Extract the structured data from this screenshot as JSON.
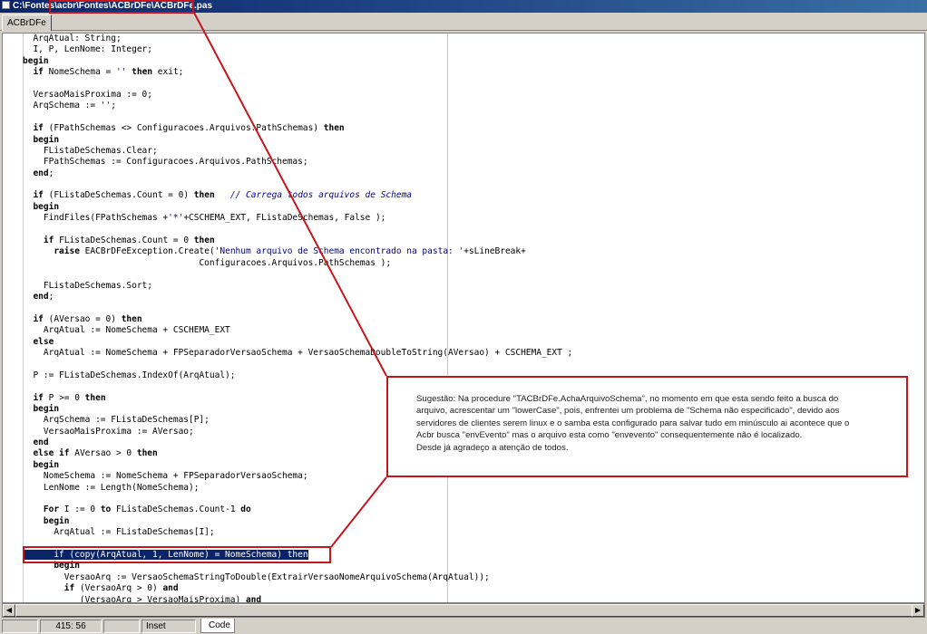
{
  "window": {
    "title": "C:\\Fontes\\acbr\\Fontes\\ACBrDFe\\ACBrDFe.pas"
  },
  "tabs": [
    {
      "label": "ACBrDFe"
    }
  ],
  "code_lines": [
    [
      {
        "t": "  ArqAtual: String;"
      }
    ],
    [
      {
        "t": "  I, P, LenNome: Integer;"
      }
    ],
    [
      {
        "t": "begin",
        "c": "kw"
      }
    ],
    [
      {
        "t": "  "
      },
      {
        "t": "if",
        "c": "kw"
      },
      {
        "t": " NomeSchema = "
      },
      {
        "t": "''",
        "c": "str"
      },
      {
        "t": " "
      },
      {
        "t": "then",
        "c": "kw"
      },
      {
        "t": " exit;"
      }
    ],
    [
      {
        "t": ""
      }
    ],
    [
      {
        "t": "  VersaoMaisProxima := 0;"
      }
    ],
    [
      {
        "t": "  ArqSchema := "
      },
      {
        "t": "''",
        "c": "str"
      },
      {
        "t": ";"
      }
    ],
    [
      {
        "t": ""
      }
    ],
    [
      {
        "t": "  "
      },
      {
        "t": "if",
        "c": "kw"
      },
      {
        "t": " (FPathSchemas <> Configuracoes.Arquivos.PathSchemas) "
      },
      {
        "t": "then",
        "c": "kw"
      }
    ],
    [
      {
        "t": "  "
      },
      {
        "t": "begin",
        "c": "kw"
      }
    ],
    [
      {
        "t": "    FListaDeSchemas.Clear;"
      }
    ],
    [
      {
        "t": "    FPathSchemas := Configuracoes.Arquivos.PathSchemas;"
      }
    ],
    [
      {
        "t": "  "
      },
      {
        "t": "end",
        "c": "kw"
      },
      {
        "t": ";"
      }
    ],
    [
      {
        "t": ""
      }
    ],
    [
      {
        "t": "  "
      },
      {
        "t": "if",
        "c": "kw"
      },
      {
        "t": " (FListaDeSchemas.Count = 0) "
      },
      {
        "t": "then",
        "c": "kw"
      },
      {
        "t": "   "
      },
      {
        "t": "// Carrega todos arquivos de Schema",
        "c": "cm"
      }
    ],
    [
      {
        "t": "  "
      },
      {
        "t": "begin",
        "c": "kw"
      }
    ],
    [
      {
        "t": "    FindFiles(FPathSchemas +"
      },
      {
        "t": "'*'",
        "c": "str"
      },
      {
        "t": "+CSCHEMA_EXT, FListaDeSchemas, False );"
      }
    ],
    [
      {
        "t": ""
      }
    ],
    [
      {
        "t": "    "
      },
      {
        "t": "if",
        "c": "kw"
      },
      {
        "t": " FListaDeSchemas.Count = 0 "
      },
      {
        "t": "then",
        "c": "kw"
      }
    ],
    [
      {
        "t": "      "
      },
      {
        "t": "raise",
        "c": "kw"
      },
      {
        "t": " EACBrDFeException.Create("
      },
      {
        "t": "'Nenhum arquivo de Schema encontrado na pasta: '",
        "c": "str"
      },
      {
        "t": "+sLineBreak+"
      }
    ],
    [
      {
        "t": "                                  Configuracoes.Arquivos.PathSchemas );"
      }
    ],
    [
      {
        "t": ""
      }
    ],
    [
      {
        "t": "    FListaDeSchemas.Sort;"
      }
    ],
    [
      {
        "t": "  "
      },
      {
        "t": "end",
        "c": "kw"
      },
      {
        "t": ";"
      }
    ],
    [
      {
        "t": ""
      }
    ],
    [
      {
        "t": "  "
      },
      {
        "t": "if",
        "c": "kw"
      },
      {
        "t": " (AVersao = 0) "
      },
      {
        "t": "then",
        "c": "kw"
      }
    ],
    [
      {
        "t": "    ArqAtual := NomeSchema + CSCHEMA_EXT"
      }
    ],
    [
      {
        "t": "  "
      },
      {
        "t": "else",
        "c": "kw"
      }
    ],
    [
      {
        "t": "    ArqAtual := NomeSchema + FPSeparadorVersaoSchema + VersaoSchemaDoubleToString(AVersao) + CSCHEMA_EXT ;"
      }
    ],
    [
      {
        "t": ""
      }
    ],
    [
      {
        "t": "  P := FListaDeSchemas.IndexOf(ArqAtual);"
      }
    ],
    [
      {
        "t": ""
      }
    ],
    [
      {
        "t": "  "
      },
      {
        "t": "if",
        "c": "kw"
      },
      {
        "t": " P >= 0 "
      },
      {
        "t": "then",
        "c": "kw"
      }
    ],
    [
      {
        "t": "  "
      },
      {
        "t": "begin",
        "c": "kw"
      }
    ],
    [
      {
        "t": "    ArqSchema := FListaDeSchemas[P];"
      }
    ],
    [
      {
        "t": "    VersaoMaisProxima := AVersao;"
      }
    ],
    [
      {
        "t": "  "
      },
      {
        "t": "end",
        "c": "kw"
      }
    ],
    [
      {
        "t": "  "
      },
      {
        "t": "else if",
        "c": "kw"
      },
      {
        "t": " AVersao > 0 "
      },
      {
        "t": "then",
        "c": "kw"
      }
    ],
    [
      {
        "t": "  "
      },
      {
        "t": "begin",
        "c": "kw"
      }
    ],
    [
      {
        "t": "    NomeSchema := NomeSchema + FPSeparadorVersaoSchema;"
      }
    ],
    [
      {
        "t": "    LenNome := Length(NomeSchema);"
      }
    ],
    [
      {
        "t": ""
      }
    ],
    [
      {
        "t": "    "
      },
      {
        "t": "For",
        "c": "kw"
      },
      {
        "t": " I := 0 "
      },
      {
        "t": "to",
        "c": "kw"
      },
      {
        "t": " FListaDeSchemas.Count-1 "
      },
      {
        "t": "do",
        "c": "kw"
      }
    ],
    [
      {
        "t": "    "
      },
      {
        "t": "begin",
        "c": "kw"
      }
    ],
    [
      {
        "t": "      ArqAtual := FListaDeSchemas[I];"
      }
    ],
    [
      {
        "t": ""
      }
    ],
    [
      {
        "t": "      if (copy(ArqAtual, 1, LenNome) = NomeSchema) then",
        "c": "sel"
      }
    ],
    [
      {
        "t": "      "
      },
      {
        "t": "begin",
        "c": "kw"
      }
    ],
    [
      {
        "t": "        VersaoArq := VersaoSchemaStringToDouble(ExtrairVersaoNomeArquivoSchema(ArqAtual));"
      }
    ],
    [
      {
        "t": "        "
      },
      {
        "t": "if",
        "c": "kw"
      },
      {
        "t": " (VersaoArq > 0) "
      },
      {
        "t": "and",
        "c": "kw"
      }
    ],
    [
      {
        "t": "           (VersaoArq > VersaoMaisProxima) "
      },
      {
        "t": "and",
        "c": "kw"
      }
    ]
  ],
  "statusbar": {
    "cursor": "415: 56",
    "mode": "Inset",
    "code_tab": "Code"
  },
  "callout": {
    "lines": [
      "Sugestão: Na procedure \"TACBrDFe.AchaArquivoSchema\", no momento em que esta sendo feito a busca do",
      "arquivo, acrescentar um \"lowerCase\", pois, enfrentei um problema de \"Schema não especificado\", devido aos",
      "servidores de clientes serem linux e o samba esta configurado para salvar tudo em minúsculo ai acontece que o",
      "Acbr busca \"envEvento\" mas o arquivo esta como \"envevento\" consequentemente não é localizado.",
      "Desde já agradeço a atenção de todos."
    ]
  },
  "colors": {
    "annotation": "#c4161c",
    "selection": "#0a246a",
    "titlebar": "#0a246a"
  }
}
